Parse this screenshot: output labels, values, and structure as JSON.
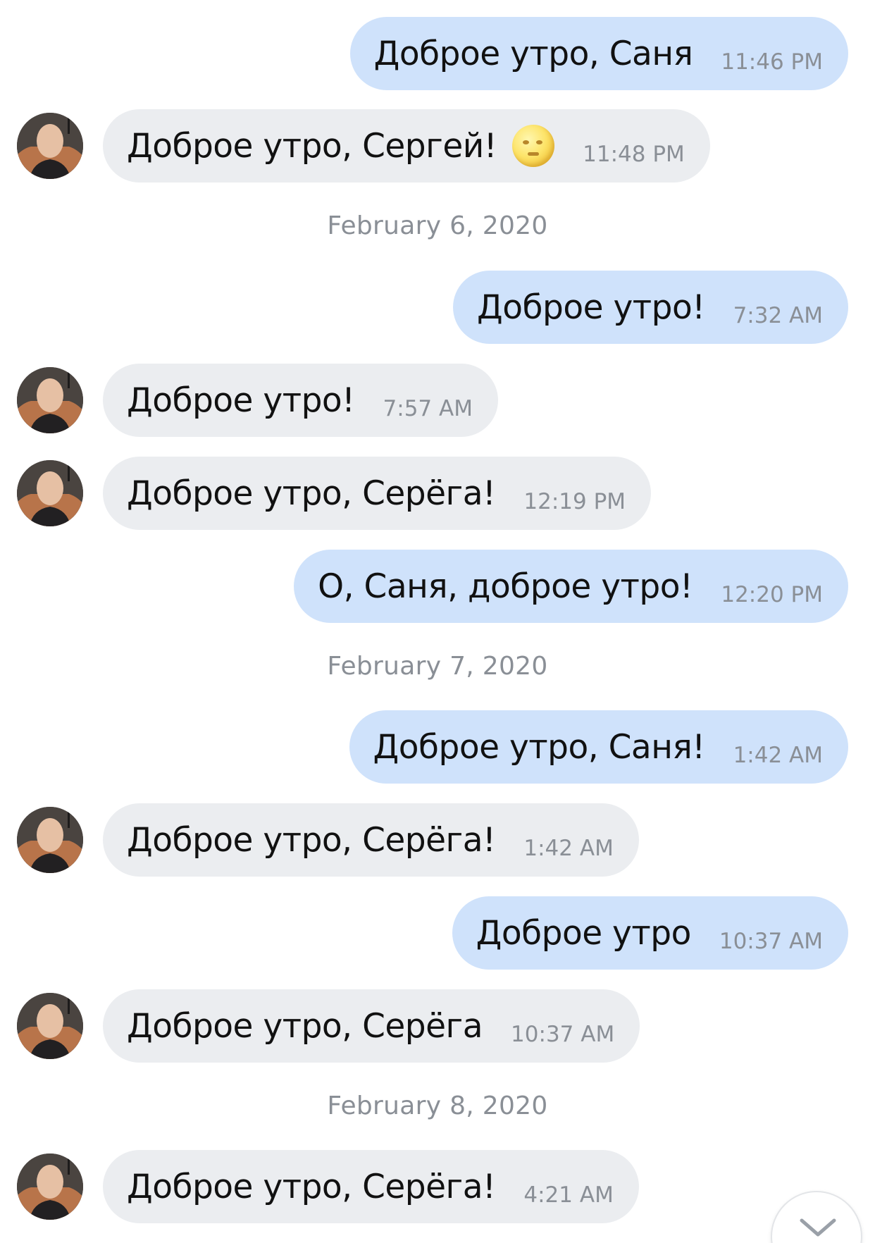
{
  "messages": [
    {
      "direction": "out",
      "text": "Доброе утро, Саня",
      "time": "11:46 PM"
    },
    {
      "direction": "in",
      "text": "Доброе утро, Сергей!",
      "time": "11:48 PM",
      "emoji": "full-moon-face-icon"
    },
    {
      "type": "date",
      "text": "February 6, 2020"
    },
    {
      "direction": "out",
      "text": "Доброе утро!",
      "time": "7:32 AM"
    },
    {
      "direction": "in",
      "text": "Доброе утро!",
      "time": "7:57 AM"
    },
    {
      "direction": "in",
      "text": "Доброе утро, Серёга!",
      "time": "12:19 PM"
    },
    {
      "direction": "out",
      "text": "О, Саня, доброе утро!",
      "time": "12:20 PM"
    },
    {
      "type": "date",
      "text": "February 7, 2020"
    },
    {
      "direction": "out",
      "text": "Доброе утро, Саня!",
      "time": "1:42 AM"
    },
    {
      "direction": "in",
      "text": "Доброе утро, Серёга!",
      "time": "1:42 AM"
    },
    {
      "direction": "out",
      "text": "Доброе утро",
      "time": "10:37 AM"
    },
    {
      "direction": "in",
      "text": "Доброе утро, Серёга",
      "time": "10:37 AM"
    },
    {
      "type": "date",
      "text": "February 8, 2020"
    },
    {
      "direction": "in",
      "text": "Доброе утро, Серёга!",
      "time": "4:21 AM"
    }
  ],
  "colors": {
    "outgoing_bubble": "#cfe2fb",
    "incoming_bubble": "#ebedf0",
    "timestamp": "#8a8f96"
  },
  "scroll_button": {
    "icon": "chevron-down-icon"
  }
}
